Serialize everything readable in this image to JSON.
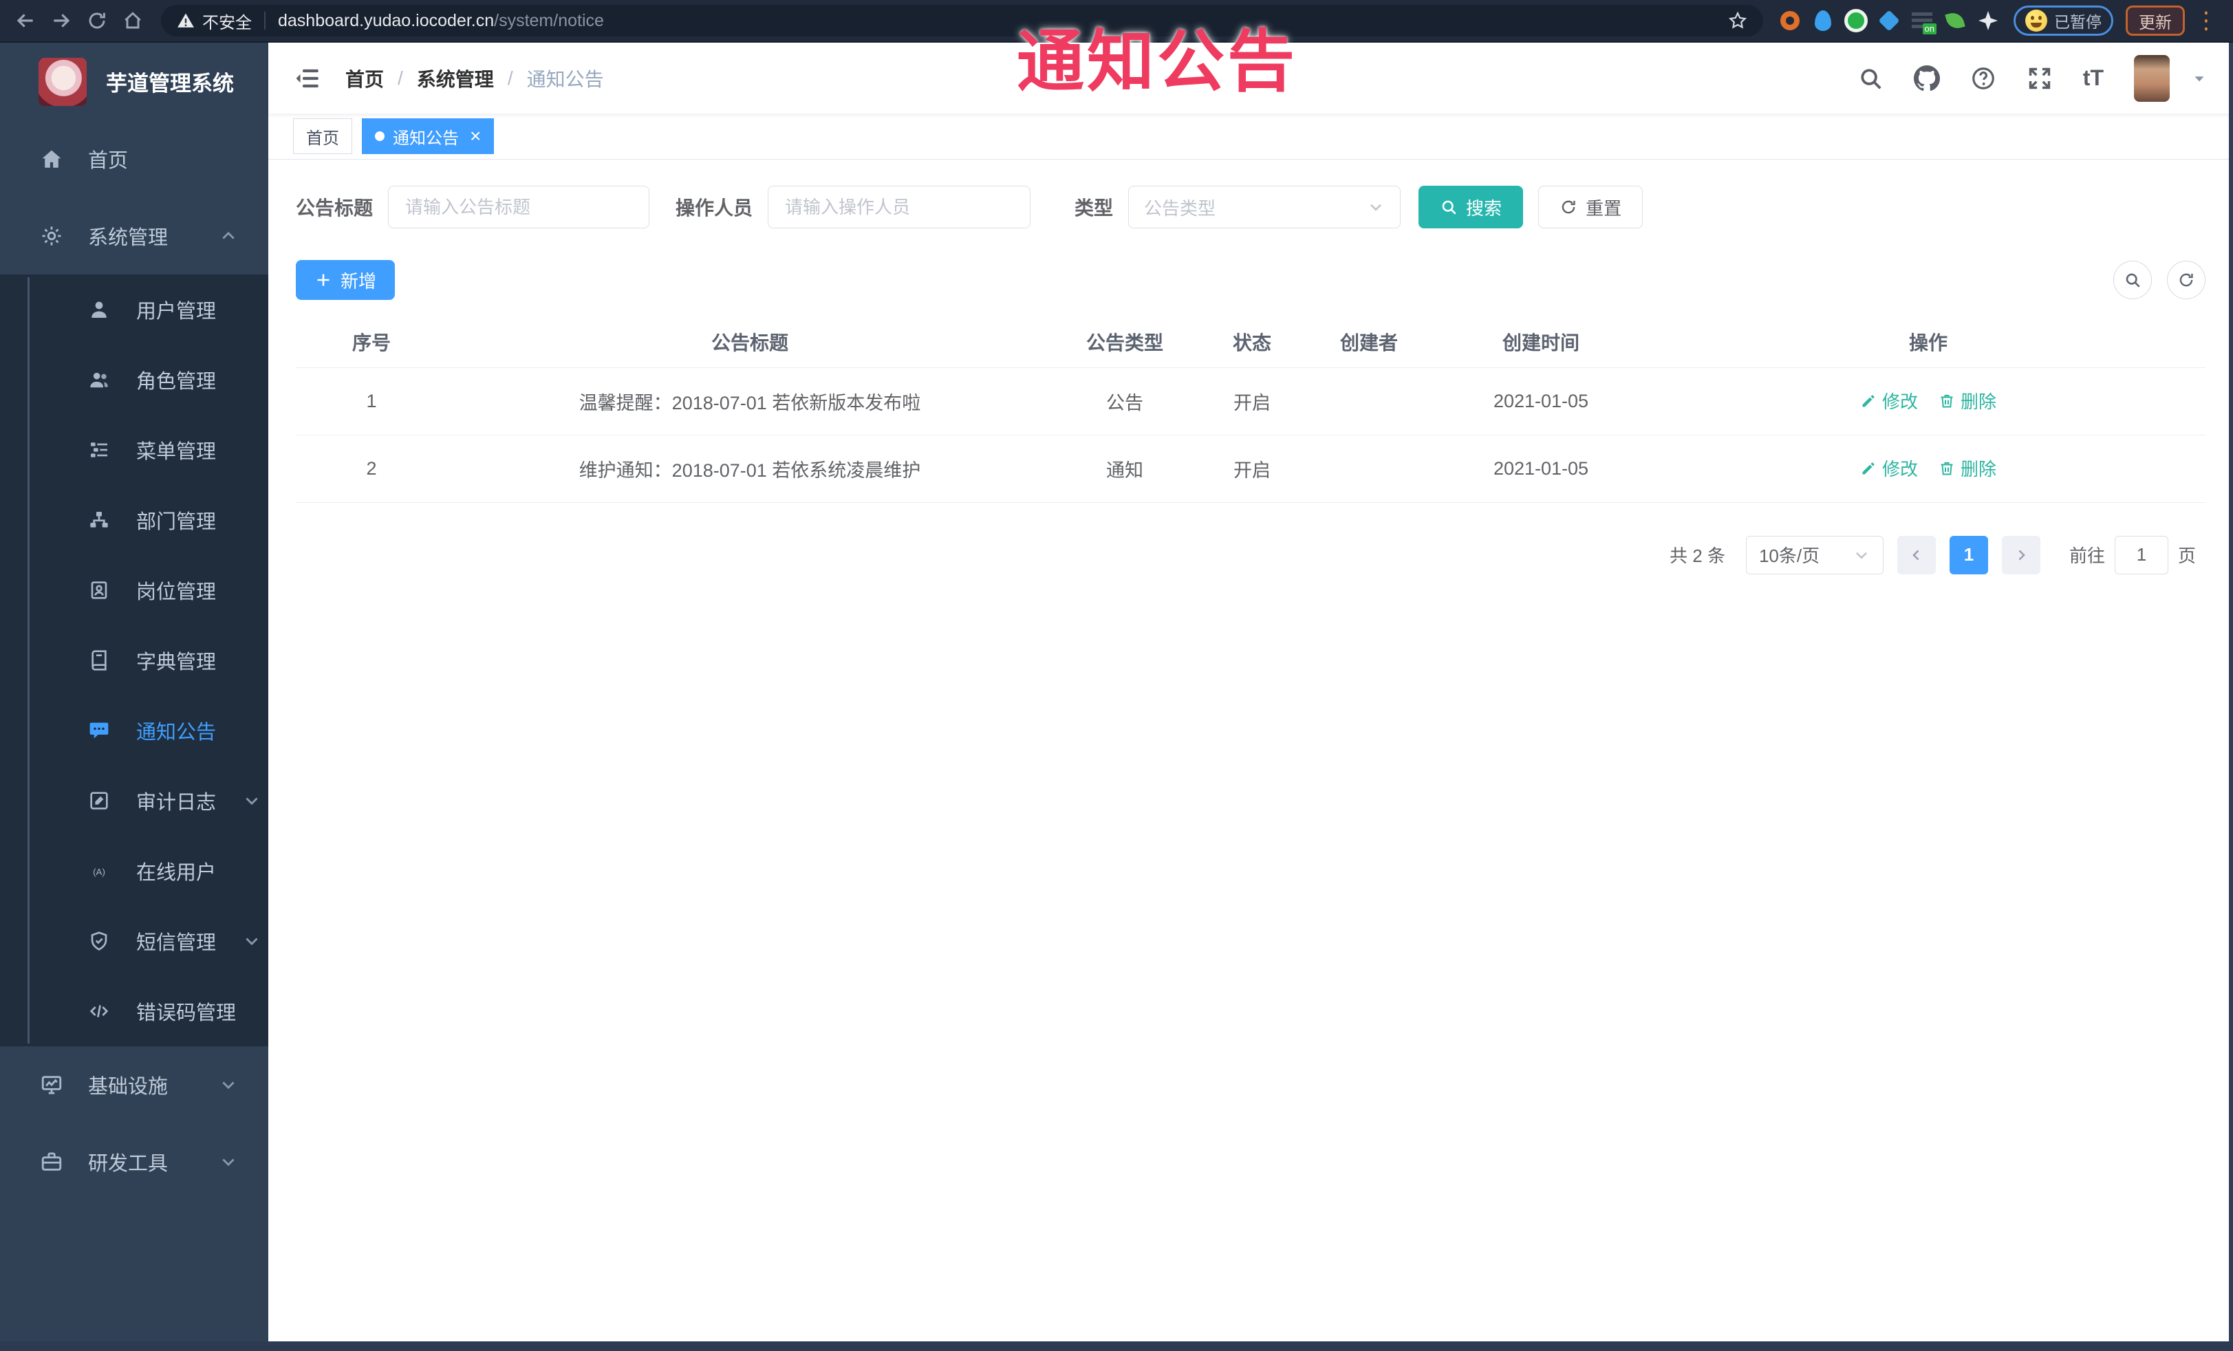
{
  "browser": {
    "security_label": "不安全",
    "url_host": "dashboard.yudao.iocoder.cn",
    "url_path": "/system/notice",
    "paused_badge": "已暂停",
    "update_label": "更新"
  },
  "overlay": {
    "title": "通知公告",
    "color": "#ee3b5f"
  },
  "sidebar": {
    "logo_title": "芋道管理系统",
    "menu": [
      {
        "key": "home",
        "label": "首页",
        "icon": "home-icon",
        "level": 1
      },
      {
        "key": "system",
        "label": "系统管理",
        "icon": "gear-icon",
        "level": 1,
        "chevron": "up"
      },
      {
        "key": "user",
        "label": "用户管理",
        "icon": "user-icon",
        "level": 2
      },
      {
        "key": "role",
        "label": "角色管理",
        "icon": "users-icon",
        "level": 2
      },
      {
        "key": "menu",
        "label": "菜单管理",
        "icon": "tree-icon",
        "level": 2
      },
      {
        "key": "dept",
        "label": "部门管理",
        "icon": "org-icon",
        "level": 2
      },
      {
        "key": "post",
        "label": "岗位管理",
        "icon": "badge-icon",
        "level": 2
      },
      {
        "key": "dict",
        "label": "字典管理",
        "icon": "dict-icon",
        "level": 2
      },
      {
        "key": "notice",
        "label": "通知公告",
        "icon": "notice-icon",
        "level": 2,
        "active": true
      },
      {
        "key": "audit-log",
        "label": "审计日志",
        "icon": "log-icon",
        "level": 2,
        "chevron": "down"
      },
      {
        "key": "online-user",
        "label": "在线用户",
        "icon": "online-icon",
        "level": 2
      },
      {
        "key": "sms",
        "label": "短信管理",
        "icon": "sms-icon",
        "level": 2,
        "chevron": "down"
      },
      {
        "key": "error-code",
        "label": "错误码管理",
        "icon": "code-icon",
        "level": 2
      },
      {
        "key": "infra",
        "label": "基础设施",
        "icon": "infra-icon",
        "level": 1,
        "chevron": "down"
      },
      {
        "key": "devtools",
        "label": "研发工具",
        "icon": "tools-icon",
        "level": 1,
        "chevron": "down"
      }
    ]
  },
  "header": {
    "breadcrumb": [
      "首页",
      "系统管理",
      "通知公告"
    ],
    "text_size_label": "tT"
  },
  "tags": [
    {
      "label": "首页",
      "active": false
    },
    {
      "label": "通知公告",
      "active": true,
      "closable": true
    }
  ],
  "filters": {
    "title_label": "公告标题",
    "title_placeholder": "请输入公告标题",
    "operator_label": "操作人员",
    "operator_placeholder": "请输入操作人员",
    "type_label": "类型",
    "type_placeholder": "公告类型",
    "search_label": "搜索",
    "reset_label": "重置"
  },
  "toolbar": {
    "add_label": "新增"
  },
  "table": {
    "columns": [
      "序号",
      "公告标题",
      "公告类型",
      "状态",
      "创建者",
      "创建时间",
      "操作"
    ],
    "rows": [
      {
        "seq": "1",
        "title": "温馨提醒：2018-07-01 若依新版本发布啦",
        "type": "公告",
        "status": "开启",
        "creator": "",
        "created": "2021-01-05"
      },
      {
        "seq": "2",
        "title": "维护通知：2018-07-01 若依系统凌晨维护",
        "type": "通知",
        "status": "开启",
        "creator": "",
        "created": "2021-01-05"
      }
    ],
    "edit_label": "修改",
    "delete_label": "删除"
  },
  "pagination": {
    "total": "共 2 条",
    "page_size": "10条/页",
    "current": "1",
    "goto_label": "前往",
    "goto_value": "1",
    "page_unit": "页"
  },
  "colors": {
    "primary": "#409eff",
    "search_button": "#26b6ae",
    "action_link": "#2cb5a0",
    "overlay_text": "#ee3b5f",
    "sidebar_bg": "#304156",
    "submenu_bg": "#1f2d3d"
  }
}
